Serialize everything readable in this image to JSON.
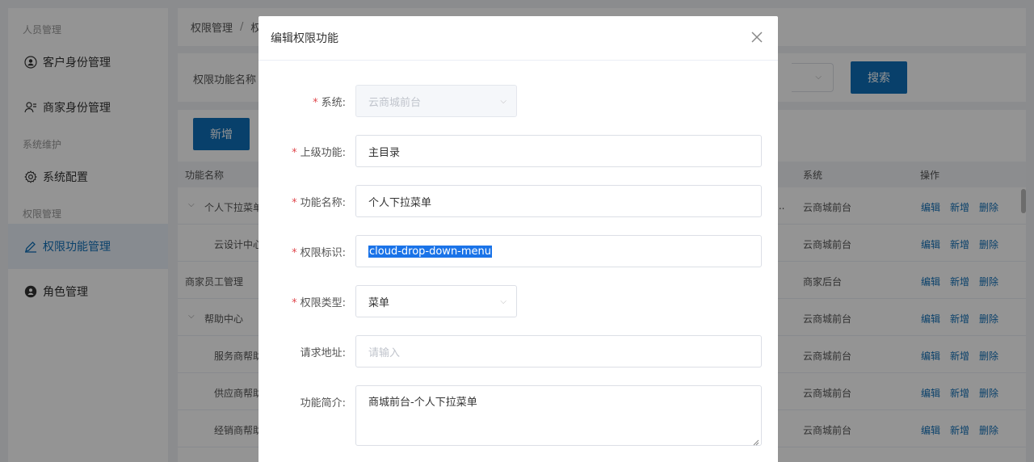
{
  "sidebar": {
    "groups": [
      {
        "label": "人员管理",
        "items": [
          {
            "label": "客户身份管理",
            "icon": "user-circle-icon"
          },
          {
            "label": "商家身份管理",
            "icon": "merchant-user-icon"
          }
        ]
      },
      {
        "label": "系统维护",
        "items": [
          {
            "label": "系统配置",
            "icon": "gear-icon"
          }
        ]
      },
      {
        "label": "权限管理",
        "items": [
          {
            "label": "权限功能管理",
            "icon": "permission-edit-icon",
            "active": true
          },
          {
            "label": "角色管理",
            "icon": "role-icon"
          }
        ]
      }
    ]
  },
  "breadcrumb": {
    "item1": "权限管理",
    "separator": "/",
    "item2": "权"
  },
  "filter": {
    "label": "权限功能名称",
    "search_button": "搜索"
  },
  "toolbar": {
    "add_button": "新增"
  },
  "table": {
    "headers": {
      "name": "功能名称",
      "system": "系统",
      "actions": "操作"
    },
    "action_labels": {
      "edit": "编辑",
      "add": "新增",
      "delete": "删除"
    },
    "truncation": "...",
    "rows": [
      {
        "name": "个人下拉菜单",
        "system": "云商城前台",
        "level": 0,
        "expandable": true
      },
      {
        "name": "云设计中心",
        "system": "云商城前台",
        "level": 1
      },
      {
        "name": "商家员工管理",
        "system": "商家后台",
        "level": 0
      },
      {
        "name": "帮助中心",
        "system": "云商城前台",
        "level": 0,
        "expandable": true
      },
      {
        "name": "服务商帮助",
        "system": "云商城前台",
        "level": 1
      },
      {
        "name": "供应商帮助",
        "system": "云商城前台",
        "level": 1
      },
      {
        "name": "经销商帮助",
        "system": "云商城前台",
        "level": 1
      }
    ]
  },
  "modal": {
    "title": "编辑权限功能",
    "fields": {
      "system": {
        "label": "系统:",
        "value": "云商城前台",
        "required": true,
        "disabled": true
      },
      "parent": {
        "label": "上级功能:",
        "value": "主目录",
        "required": true
      },
      "name": {
        "label": "功能名称:",
        "value": "个人下拉菜单",
        "required": true
      },
      "identifier": {
        "label": "权限标识:",
        "value": "cloud-drop-down-menu",
        "required": true
      },
      "type": {
        "label": "权限类型:",
        "value": "菜单",
        "required": true
      },
      "url": {
        "label": "请求地址:",
        "placeholder": "请输入"
      },
      "description": {
        "label": "功能简介:",
        "value": "商城前台-个人下拉菜单"
      }
    },
    "required_mark": "*"
  },
  "colors": {
    "primary": "#0e6fb8",
    "link": "#1270b8",
    "required": "#e0474c",
    "active_bg": "#e8f0f8"
  }
}
